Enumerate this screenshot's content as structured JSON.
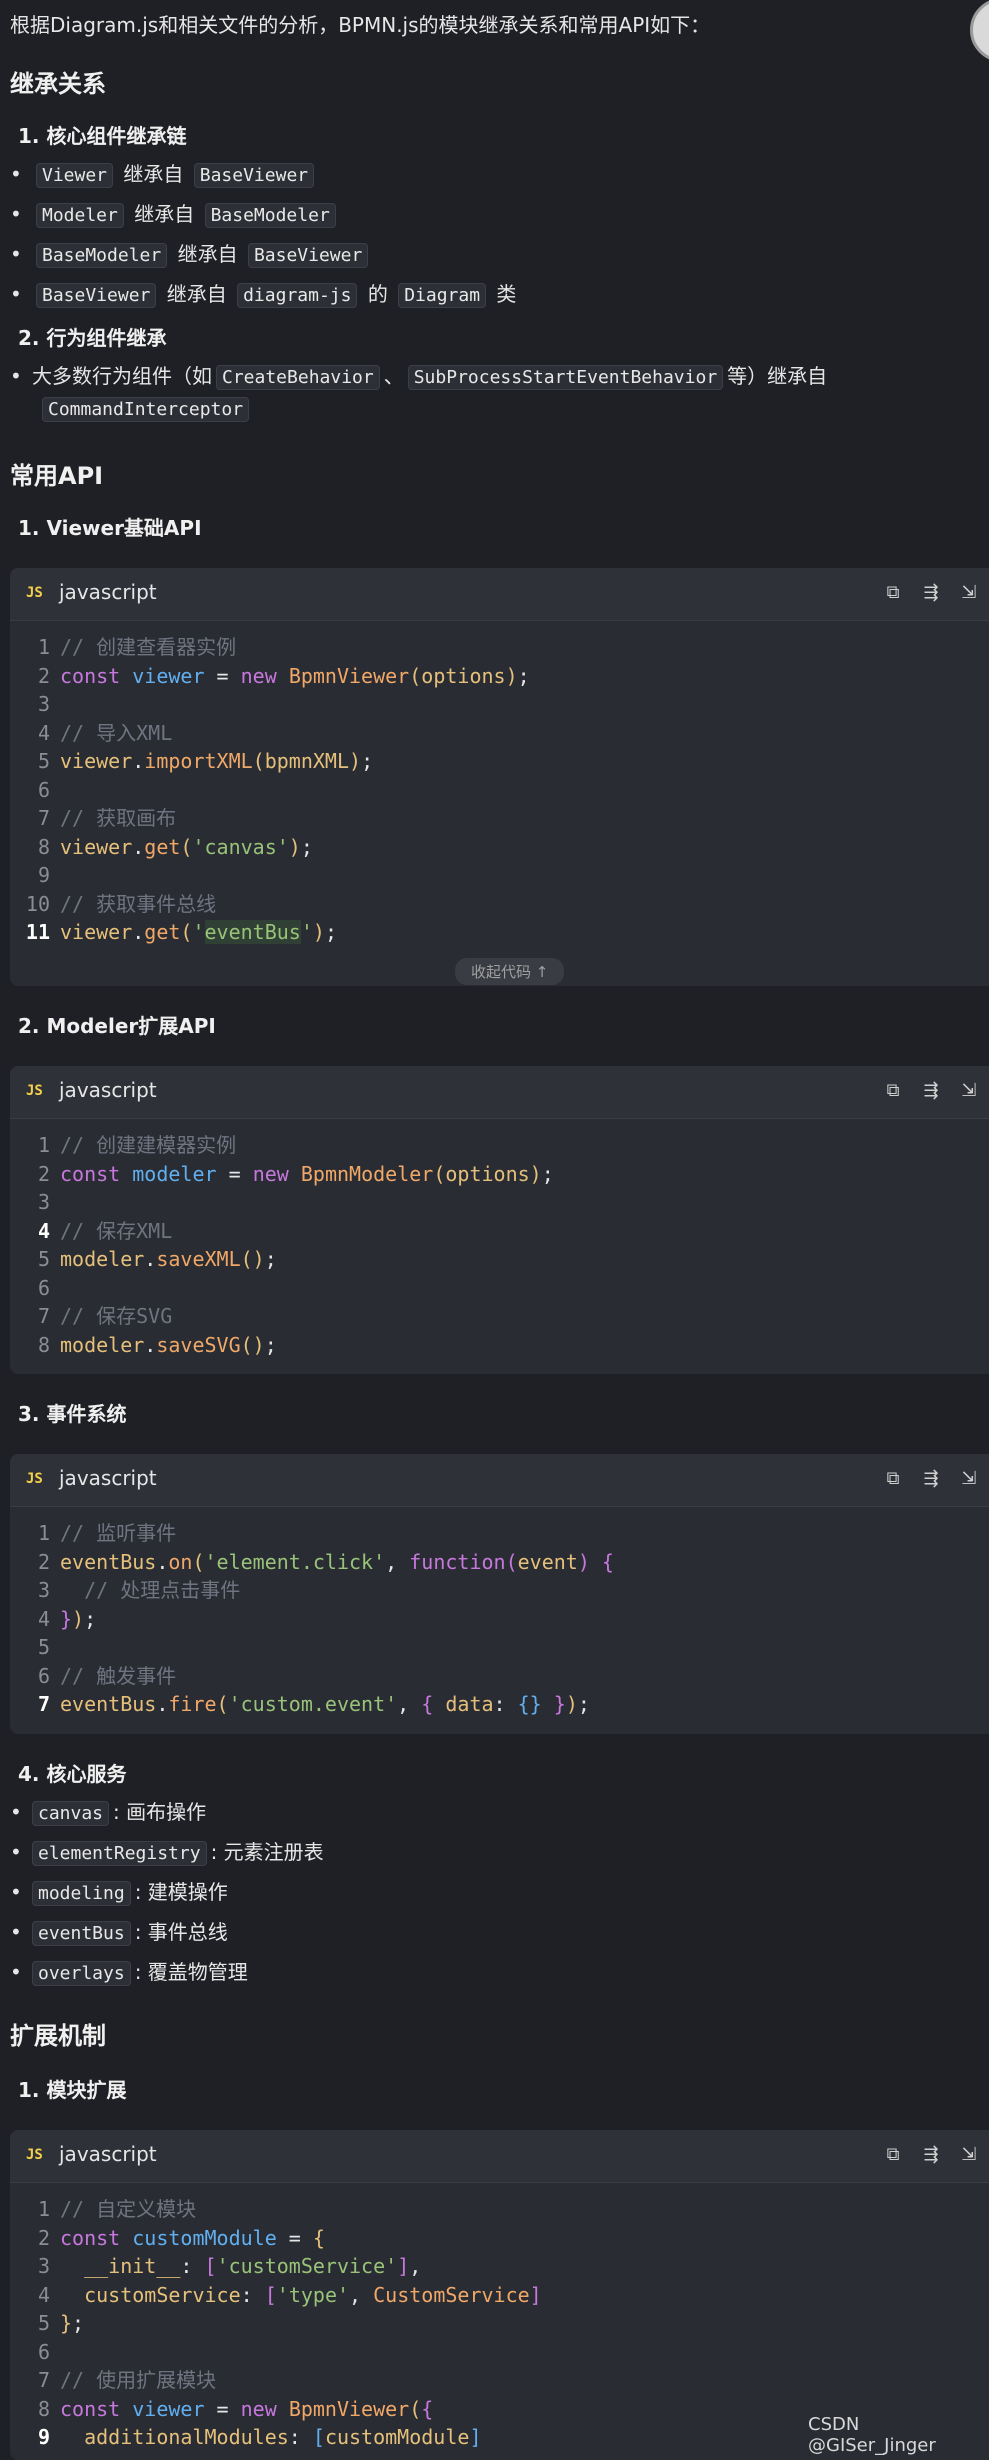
{
  "intro": "根据Diagram.js和相关文件的分析，BPMN.js的模块继承关系和常用API如下：",
  "sections": {
    "inheritance": "继承关系",
    "api": "常用API",
    "extension": "扩展机制"
  },
  "inheritance": {
    "chain_title": "1. 核心组件继承链",
    "chain": [
      {
        "a": "Viewer",
        "mid": "继承自",
        "b": "BaseViewer"
      },
      {
        "a": "Modeler",
        "mid": "继承自",
        "b": "BaseModeler"
      },
      {
        "a": "BaseModeler",
        "mid": "继承自",
        "b": "BaseViewer"
      },
      {
        "a": "BaseViewer",
        "mid": "继承自",
        "b": "diagram-js",
        "mid2": "的",
        "c": "Diagram",
        "end": "类"
      }
    ],
    "behavior_title": "2. 行为组件继承",
    "behavior_line1_a": "大多数行为组件（如",
    "behavior_line1_c1": "CreateBehavior",
    "behavior_line1_sep": "、",
    "behavior_line1_c2": "SubProcessStartEventBehavior",
    "behavior_line1_b": "等）继承自",
    "behavior_line2_c": "CommandInterceptor"
  },
  "api": {
    "viewer_title": "1. Viewer基础API",
    "modeler_title": "2. Modeler扩展API",
    "events_title": "3. 事件系统",
    "services_title": "4. 核心服务",
    "services": [
      {
        "name": "canvas",
        "desc": ": 画布操作"
      },
      {
        "name": "elementRegistry",
        "desc": ": 元素注册表"
      },
      {
        "name": "modeling",
        "desc": ": 建模操作"
      },
      {
        "name": "eventBus",
        "desc": ": 事件总线"
      },
      {
        "name": "overlays",
        "desc": ": 覆盖物管理"
      }
    ]
  },
  "extension": {
    "module_title": "1. 模块扩展"
  },
  "code_block": {
    "badge": "JS",
    "lang": "javascript",
    "collapse_label": "收起代码 ↑"
  },
  "icons": [
    "copy-icon",
    "wrap-icon",
    "insert-icon"
  ],
  "watermark": "CSDN @GISer_Jinger"
}
